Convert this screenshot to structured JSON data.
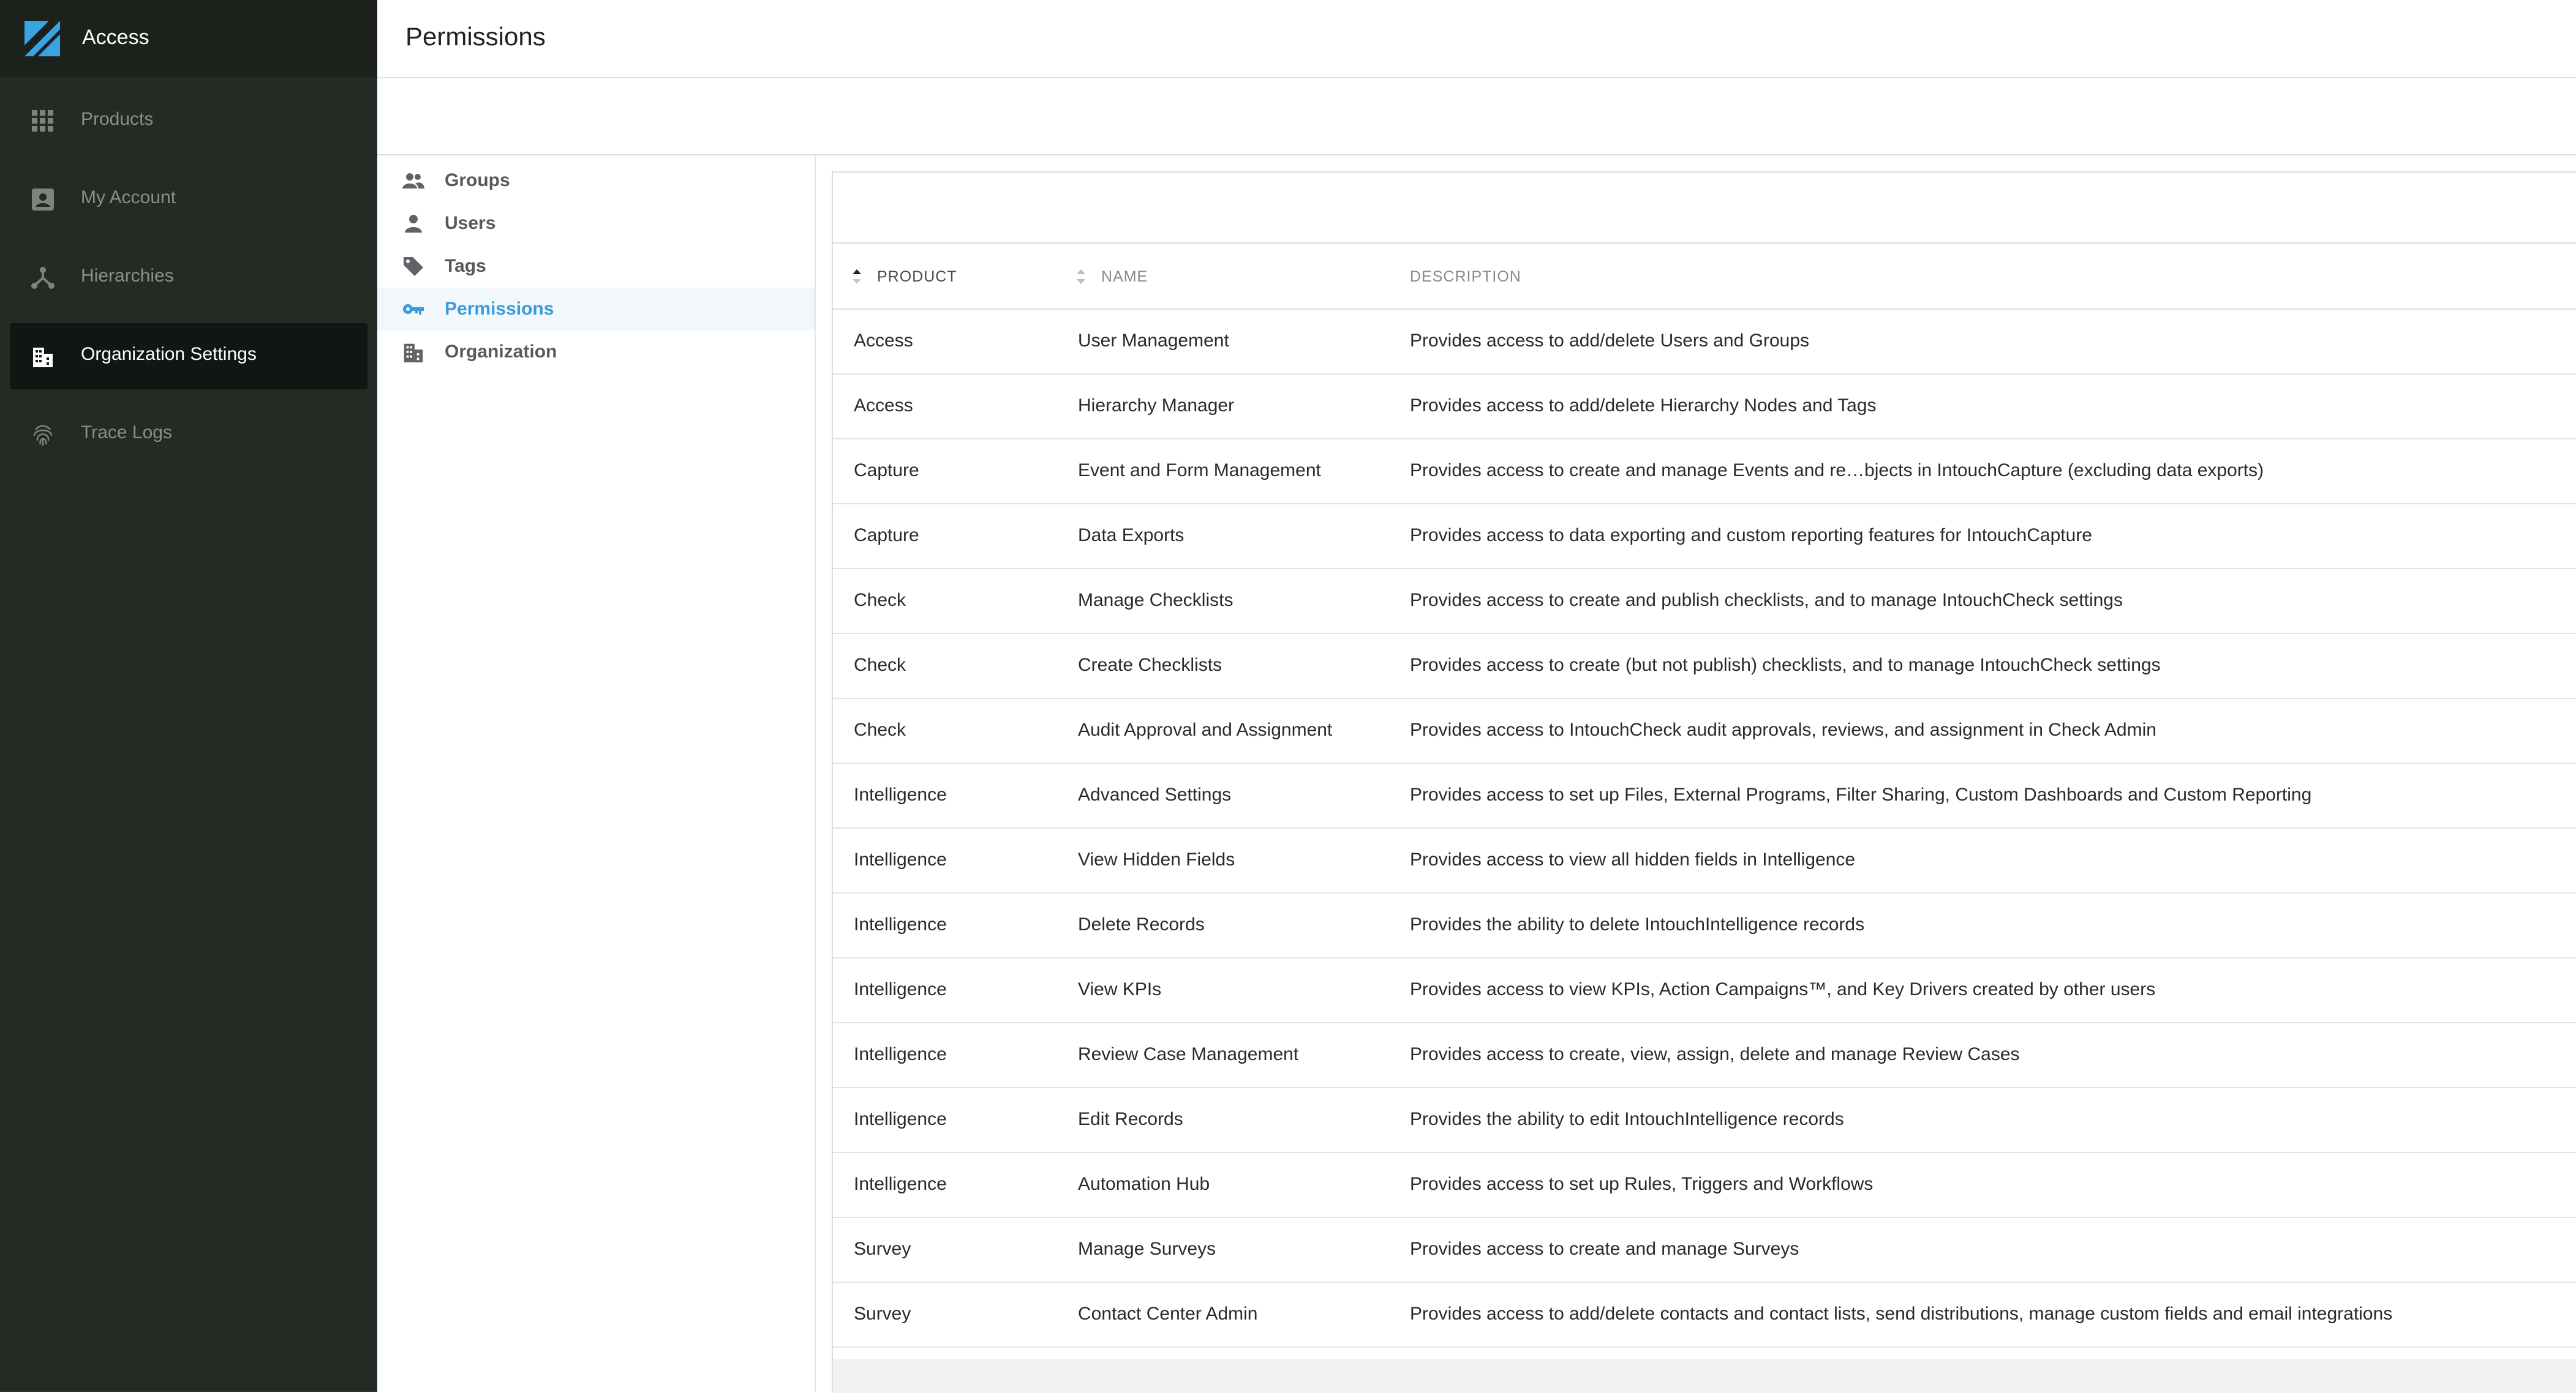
{
  "app": {
    "title": "Access",
    "colors": {
      "sidebar": "#242a24",
      "header": "#1c211c",
      "logo": "#3aa3e3",
      "accent": "#3a9bd9"
    }
  },
  "sidebar": {
    "items": [
      {
        "label": "Products",
        "icon": "grid-icon"
      },
      {
        "label": "My Account",
        "icon": "account-box-icon"
      },
      {
        "label": "Hierarchies",
        "icon": "hierarchy-icon"
      },
      {
        "label": "Organization Settings",
        "icon": "building-icon",
        "active": true
      },
      {
        "label": "Trace Logs",
        "icon": "fingerprint-icon"
      }
    ]
  },
  "page": {
    "title": "Permissions"
  },
  "subnav": {
    "items": [
      {
        "label": "Groups",
        "icon": "groups-icon"
      },
      {
        "label": "Users",
        "icon": "user-icon"
      },
      {
        "label": "Tags",
        "icon": "tag-icon"
      },
      {
        "label": "Permissions",
        "icon": "key-icon",
        "active": true
      },
      {
        "label": "Organization",
        "icon": "building-icon"
      }
    ]
  },
  "table": {
    "headers": {
      "product": "PRODUCT",
      "name": "NAME",
      "description": "DESCRIPTION"
    },
    "rows": [
      {
        "product": "Access",
        "name": "User Management",
        "description": "Provides access to add/delete Users and Groups"
      },
      {
        "product": "Access",
        "name": "Hierarchy Manager",
        "description": "Provides access to add/delete Hierarchy Nodes and Tags"
      },
      {
        "product": "Capture",
        "name": "Event and Form Management",
        "description": "Provides access to create and manage Events and re…bjects in IntouchCapture (excluding data exports)"
      },
      {
        "product": "Capture",
        "name": "Data Exports",
        "description": "Provides access to data exporting and custom reporting features for IntouchCapture"
      },
      {
        "product": "Check",
        "name": "Manage Checklists",
        "description": "Provides access to create and publish checklists, and to manage IntouchCheck settings"
      },
      {
        "product": "Check",
        "name": "Create Checklists",
        "description": "Provides access to create (but not publish) checklists, and to manage IntouchCheck settings"
      },
      {
        "product": "Check",
        "name": "Audit Approval and Assignment",
        "description": "Provides access to IntouchCheck audit approvals, reviews, and assignment in Check Admin"
      },
      {
        "product": "Intelligence",
        "name": "Advanced Settings",
        "description": "Provides access to set up Files, External Programs, Filter Sharing, Custom Dashboards and Custom Reporting"
      },
      {
        "product": "Intelligence",
        "name": "View Hidden Fields",
        "description": "Provides access to view all hidden fields in Intelligence"
      },
      {
        "product": "Intelligence",
        "name": "Delete Records",
        "description": "Provides the ability to delete IntouchIntelligence records"
      },
      {
        "product": "Intelligence",
        "name": "View KPIs",
        "description": "Provides access to view KPIs, Action Campaigns™, and Key Drivers created by other users"
      },
      {
        "product": "Intelligence",
        "name": "Review Case Management",
        "description": "Provides access to create, view, assign, delete and manage Review Cases"
      },
      {
        "product": "Intelligence",
        "name": "Edit Records",
        "description": "Provides the ability to edit IntouchIntelligence records"
      },
      {
        "product": "Intelligence",
        "name": "Automation Hub",
        "description": "Provides access to set up Rules, Triggers and Workflows"
      },
      {
        "product": "Survey",
        "name": "Manage Surveys",
        "description": "Provides access to create and manage Surveys"
      },
      {
        "product": "Survey",
        "name": "Contact Center Admin",
        "description": "Provides access to add/delete contacts and contact lists, send distributions, manage custom fields and email integrations"
      }
    ]
  }
}
